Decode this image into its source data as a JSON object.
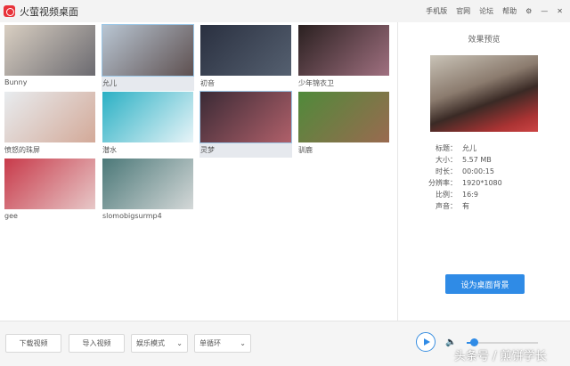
{
  "app": {
    "title": "火萤视频桌面",
    "links": [
      "手机版",
      "官网",
      "论坛",
      "帮助"
    ]
  },
  "videos": [
    {
      "label": "Bunny",
      "colors": [
        "#d9cfc2",
        "#6b6a70"
      ]
    },
    {
      "label": "允儿",
      "colors": [
        "#b9c6d3",
        "#5e5050"
      ],
      "selected": true
    },
    {
      "label": "初音",
      "colors": [
        "#2a3040",
        "#556070"
      ]
    },
    {
      "label": "少年锦衣卫",
      "colors": [
        "#2a2020",
        "#a07080"
      ]
    },
    {
      "label": "愤怒的珠屏",
      "colors": [
        "#e8ecef",
        "#d3a998"
      ]
    },
    {
      "label": "潜水",
      "colors": [
        "#2ab0c4",
        "#e8f4f8"
      ]
    },
    {
      "label": "灵梦",
      "colors": [
        "#3a2a35",
        "#b0606a"
      ],
      "selected": true
    },
    {
      "label": "驯鹿",
      "colors": [
        "#4f8a3a",
        "#9a6a50"
      ]
    },
    {
      "label": "gee",
      "colors": [
        "#c83a4a",
        "#e7c8c8"
      ]
    },
    {
      "label": "slomobigsurmp4",
      "colors": [
        "#4b7878",
        "#d4d8d8"
      ]
    }
  ],
  "preview": {
    "title": "效果预览",
    "fields": [
      {
        "k": "标题：",
        "v": "允儿"
      },
      {
        "k": "大小：",
        "v": "5.57 MB"
      },
      {
        "k": "时长：",
        "v": "00:00:15"
      },
      {
        "k": "分辨率：",
        "v": "1920*1080"
      },
      {
        "k": "比例：",
        "v": "16:9"
      },
      {
        "k": "声音：",
        "v": "有"
      }
    ],
    "set_bg": "设为桌面背景"
  },
  "bottom": {
    "download": "下载视频",
    "import": "导入视频",
    "mode": "娱乐模式",
    "loop": "单循环",
    "volume": 0.1
  },
  "watermark": "头条号 / 煎饼学长"
}
